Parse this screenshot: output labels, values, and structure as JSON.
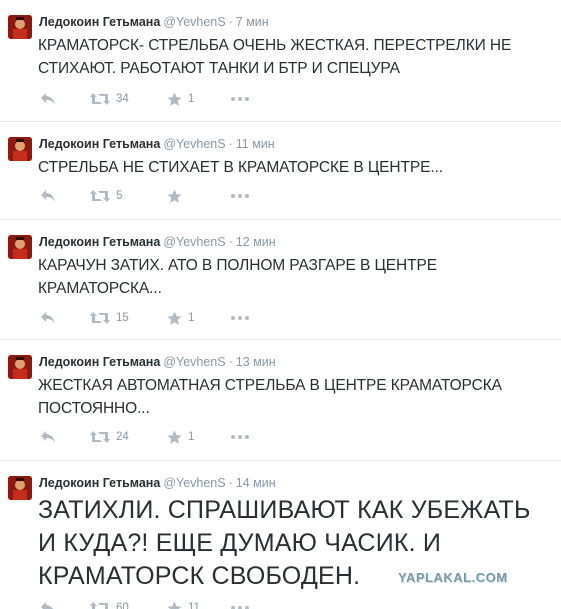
{
  "tweets": [
    {
      "name": "Ледокоин Гетьмана",
      "handle": "@YevhenS",
      "time": "7 мин",
      "text": "КРАМАТОРСК- СТРЕЛЬБА ОЧЕНЬ ЖЕСТКАЯ. ПЕРЕСТРЕЛКИ НЕ СТИХАЮТ. РАБОТАЮТ ТАНКИ И БТР И СПЕЦУРА",
      "retweets": "34",
      "favorites": "1"
    },
    {
      "name": "Ледокоин Гетьмана",
      "handle": "@YevhenS",
      "time": "11 мин",
      "text": "СТРЕЛЬБА НЕ СТИХАЕТ В КРАМАТОРСКЕ В ЦЕНТРЕ...",
      "retweets": "5",
      "favorites": ""
    },
    {
      "name": "Ледокоин Гетьмана",
      "handle": "@YevhenS",
      "time": "12 мин",
      "text": "КАРАЧУН ЗАТИХ. АТО В ПОЛНОМ РАЗГАРЕ В ЦЕНТРЕ КРАМАТОРСКА...",
      "retweets": "15",
      "favorites": "1"
    },
    {
      "name": "Ледокоин Гетьмана",
      "handle": "@YevhenS",
      "time": "13 мин",
      "text": "ЖЕСТКАЯ АВТОМАТНАЯ СТРЕЛЬБА В ЦЕНТРЕ КРАМАТОРСКА ПОСТОЯННО...",
      "retweets": "24",
      "favorites": "1"
    },
    {
      "name": "Ледокоин Гетьмана",
      "handle": "@YevhenS",
      "time": "14 мин",
      "text": "ЗАТИХЛИ. СПРАШИВАЮТ КАК УБЕЖАТЬ И КУДА?! ЕЩЕ ДУМАЮ ЧАСИК. И КРАМАТОРСК СВОБОДЕН.",
      "retweets": "60",
      "favorites": "11"
    }
  ],
  "watermark": "YAPLAKAL.COM",
  "colors": {
    "text": "#292f33",
    "muted": "#8899a6",
    "icon": "#b1bbc3",
    "divider": "#e6ecf0",
    "avatar": "#8c1a12"
  },
  "icons": {
    "reply": "reply-arrow-icon",
    "retweet": "retweet-icon",
    "favorite": "star-icon",
    "more": "more-dots-icon"
  }
}
